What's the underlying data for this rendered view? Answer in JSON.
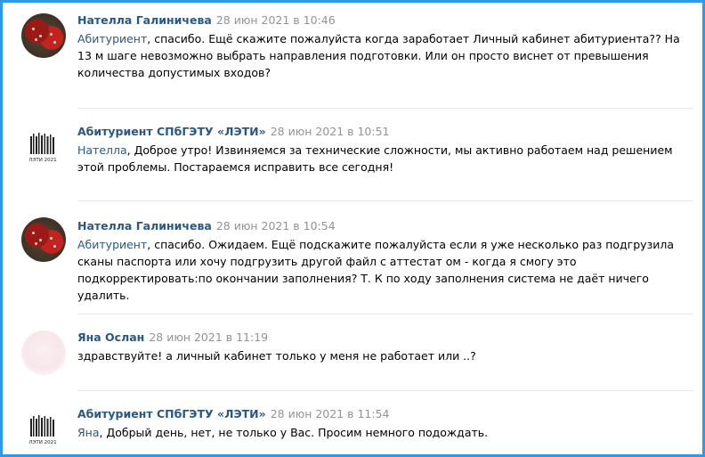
{
  "comments": [
    {
      "author": "Нателла Галиничева",
      "date": "28 июн 2021 в 10:46",
      "reply_to": "Абитуриент",
      "text": ", спасибо. Ещё скажите пожалуйста когда заработает Личный кабинет абитуриента?? На 13 м шаге невозможно выбрать направления подготовки. Или он просто виснет от превышения количества допустимых входов?",
      "avatar": "photo-avatar"
    },
    {
      "author": "Абитуриент СПбГЭТУ «ЛЭТИ»",
      "date": "28 июн 2021 в 10:51",
      "reply_to": "Нателла",
      "text": ", Доброе утро! Извиняемся за технические сложности, мы активно работаем над решением этой проблемы. Постараемся исправить все сегодня!",
      "avatar": "leti-logo",
      "logo_caption": "ЛЭТИ 2021"
    },
    {
      "author": "Нателла Галиничева",
      "date": "28 июн 2021 в 10:54",
      "reply_to": "Абитуриент",
      "text": ", спасибо. Ожидаем. Ещё подскажите пожалуйста если я уже несколько раз подгрузила сканы паспорта или хочу подгрузить другой файл с аттестат ом - когда я смогу это подкорректировать:по окончании заполнения? Т. К по ходу заполнения система не даёт ничего удалить.",
      "avatar": "photo-avatar"
    },
    {
      "author": "Яна Ослан",
      "date": "28 июн 2021 в 11:19",
      "reply_to": "",
      "text": "здравствуйте! а личный кабинет только у меня не работает или ..?",
      "avatar": "pale-avatar"
    },
    {
      "author": "Абитуриент СПбГЭТУ «ЛЭТИ»",
      "date": "28 июн 2021 в 11:54",
      "reply_to": "Яна",
      "text": ", Добрый день, нет, не только у Вас. Просим немного подождать.",
      "avatar": "leti-logo",
      "logo_caption": "ЛЭТИ 2021"
    }
  ],
  "colors": {
    "border": "#2b9ae8",
    "author": "#2a5885",
    "date": "#939393",
    "divider": "#e7e8ec"
  }
}
